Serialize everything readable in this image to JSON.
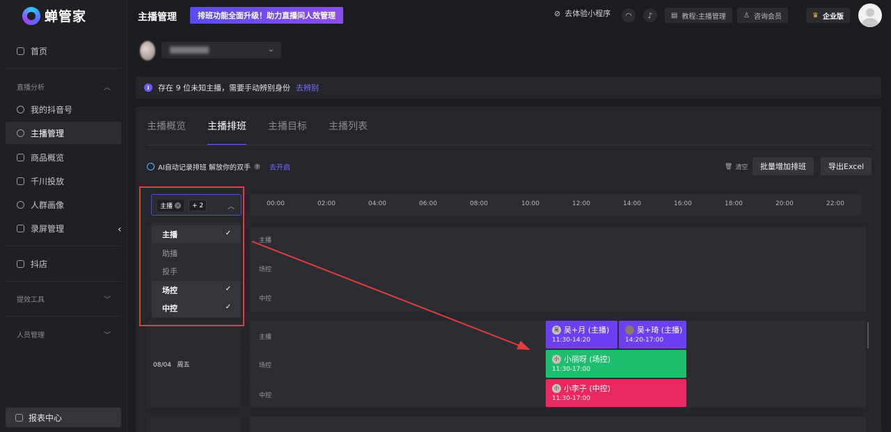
{
  "app": {
    "name": "蝉管家",
    "page_title": "主播管理",
    "promo": "排班功能全面升级！助力直播间人效管理"
  },
  "header": {
    "mini_program": "去体验小程序",
    "tutorial": "教程:主播管理",
    "consult": "咨询会员",
    "edition": "企业版"
  },
  "sidebar": {
    "home": "首页",
    "group_live": "直播分析",
    "items": [
      "我的抖音号",
      "主播管理",
      "商品概览",
      "千川投放",
      "人群画像",
      "录屏管理"
    ],
    "shop": "抖店",
    "group_tools": "提效工具",
    "group_staff": "人员管理",
    "report": "报表中心"
  },
  "notice": {
    "text": "存在 9 位未知主播，需要手动辨别身份",
    "link": "去辨别"
  },
  "tabs": [
    "主播概览",
    "主播排班",
    "主播目标",
    "主播列表"
  ],
  "toolbar": {
    "ai_text": "AI自动记录排班 解放你的双手",
    "ai_link": "去开启",
    "clear": "清空",
    "batch_add": "批量增加排班",
    "export": "导出Excel"
  },
  "filter": {
    "tag": "主播",
    "more": "+ 2",
    "options": [
      {
        "label": "主播",
        "selected": true
      },
      {
        "label": "助播",
        "selected": false
      },
      {
        "label": "投手",
        "selected": false
      },
      {
        "label": "场控",
        "selected": true
      },
      {
        "label": "中控",
        "selected": true
      }
    ],
    "check": "✓"
  },
  "timeline": [
    "00:00",
    "02:00",
    "04:00",
    "06:00",
    "08:00",
    "10:00",
    "12:00",
    "14:00",
    "16:00",
    "18:00",
    "20:00",
    "22:00"
  ],
  "schedule": {
    "rows": [
      "主播",
      "场控",
      "中控"
    ],
    "day2": {
      "date": "08/04",
      "weekday": "周五"
    },
    "shifts": [
      {
        "avatar": "吴",
        "name": "吴+月 (主播)",
        "time": "11:30-14:20",
        "color": "#6b3ff2"
      },
      {
        "avatar": "",
        "name": "吴+琦 (主播)",
        "time": "14:20-17:00",
        "color": "#6b3ff2"
      },
      {
        "avatar": "小",
        "name": "小丽呀 (场控)",
        "time": "11:30-17:00",
        "color": "#1fbe6f"
      },
      {
        "avatar": "小",
        "name": "小李子 (中控)",
        "time": "11:30-17:00",
        "color": "#e8285f"
      }
    ]
  }
}
